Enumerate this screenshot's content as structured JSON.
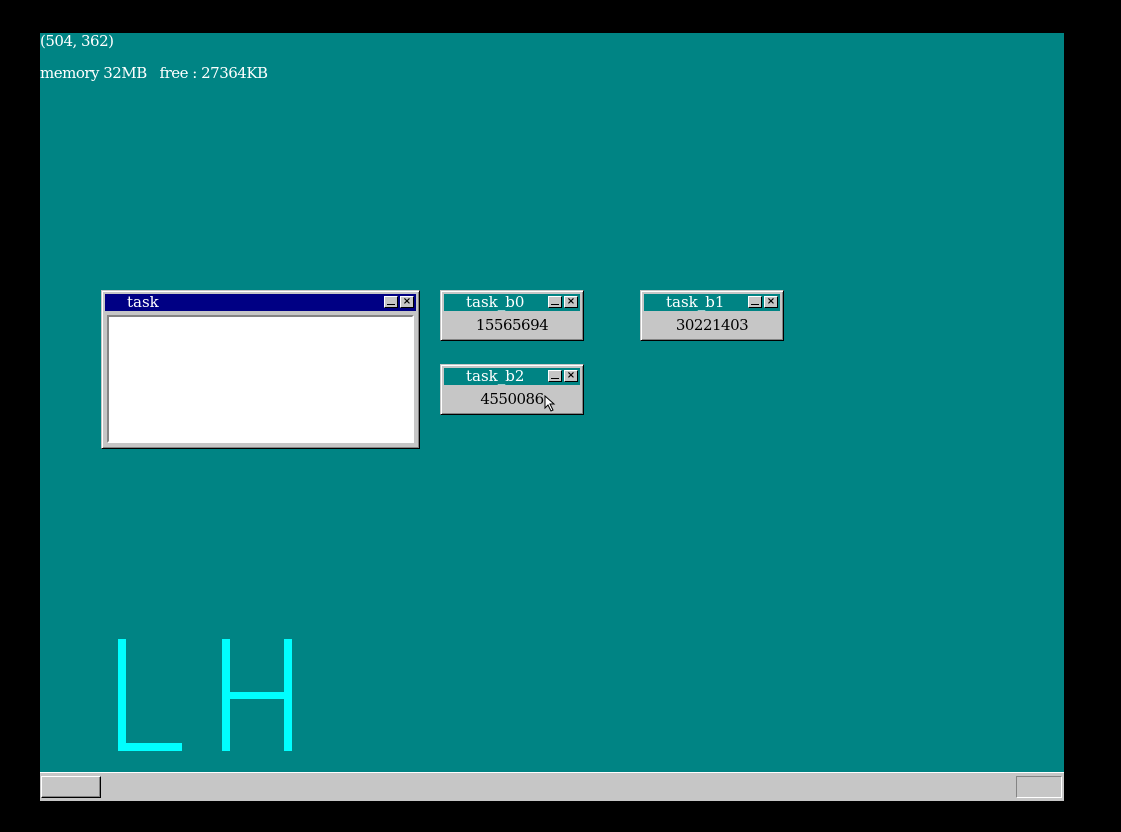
{
  "status": {
    "coords": "(504, 362)",
    "memory": "memory 32MB   free : 27364KB"
  },
  "windows": {
    "task": {
      "title": "task",
      "min_icon": "minimize-icon",
      "close_icon": "close-icon"
    },
    "task_b0": {
      "title": "task_b0",
      "counter": "15565694"
    },
    "task_b1": {
      "title": "task_b1",
      "counter": "30221403"
    },
    "task_b2": {
      "title": "task_b2",
      "counter": "4550086"
    }
  },
  "logo": {
    "text": "LH",
    "color": "#00ffff"
  },
  "colors": {
    "desktop": "#008484",
    "active_title": "#000084",
    "inactive_title": "#008484",
    "window_face": "#c6c6c6"
  },
  "cursor": {
    "icon": "mouse-pointer-icon"
  }
}
